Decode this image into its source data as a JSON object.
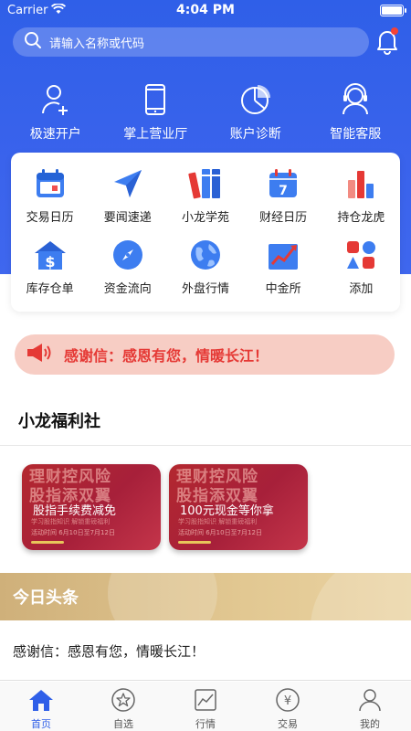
{
  "status_bar": {
    "carrier": "Carrier",
    "time": "4:04 PM",
    "battery_level": 1.0
  },
  "search": {
    "placeholder": "请输入名称或代码"
  },
  "top_actions": [
    {
      "label": "极速开户",
      "icon": "add-user-icon"
    },
    {
      "label": "掌上营业厅",
      "icon": "phone-icon"
    },
    {
      "label": "账户诊断",
      "icon": "pie-chart-icon"
    },
    {
      "label": "智能客服",
      "icon": "customer-service-icon"
    }
  ],
  "grid_items": [
    {
      "label": "交易日历",
      "icon": "calendar-icon"
    },
    {
      "label": "要闻速递",
      "icon": "paper-plane-icon"
    },
    {
      "label": "小龙学苑",
      "icon": "books-icon"
    },
    {
      "label": "财经日历",
      "icon": "calendar-7-icon"
    },
    {
      "label": "持仓龙虎",
      "icon": "bar-chart-icon"
    },
    {
      "label": "库存仓单",
      "icon": "warehouse-dollar-icon"
    },
    {
      "label": "资金流向",
      "icon": "compass-icon"
    },
    {
      "label": "外盘行情",
      "icon": "globe-icon"
    },
    {
      "label": "中金所",
      "icon": "trend-chart-icon"
    },
    {
      "label": "添加",
      "icon": "apps-add-icon"
    }
  ],
  "notice": {
    "text": "感谢信：感恩有您，情暖长江！",
    "icon": "megaphone-icon"
  },
  "welfare": {
    "title": "小龙福利社",
    "banners": [
      {
        "headline_line1": "理财控风险",
        "headline_line2": "股指添双翼",
        "title": "股指手续费减免",
        "subtitle": "学习股指知识   解锁重磅福利",
        "date": "活动时间   6月10日至7月12日"
      },
      {
        "headline_line1": "理财控风险",
        "headline_line2": "股指添双翼",
        "title": "100元现金等你拿",
        "subtitle": "学习股指知识   解锁重磅福利",
        "date": "活动时间   6月10日至7月12日"
      }
    ]
  },
  "headlines": {
    "title": "今日头条",
    "items": [
      "感谢信：感恩有您，情暖长江！"
    ]
  },
  "tabbar": [
    {
      "label": "首页",
      "icon": "home-icon",
      "active": true
    },
    {
      "label": "自选",
      "icon": "star-icon",
      "active": false
    },
    {
      "label": "行情",
      "icon": "line-chart-icon",
      "active": false
    },
    {
      "label": "交易",
      "icon": "yen-icon",
      "active": false
    },
    {
      "label": "我的",
      "icon": "user-icon",
      "active": false
    }
  ],
  "colors": {
    "primary": "#2f5fe8",
    "notice_bg": "#f7cdc4",
    "notice_text": "#e53935",
    "headline_gold": "#d9bc85"
  }
}
